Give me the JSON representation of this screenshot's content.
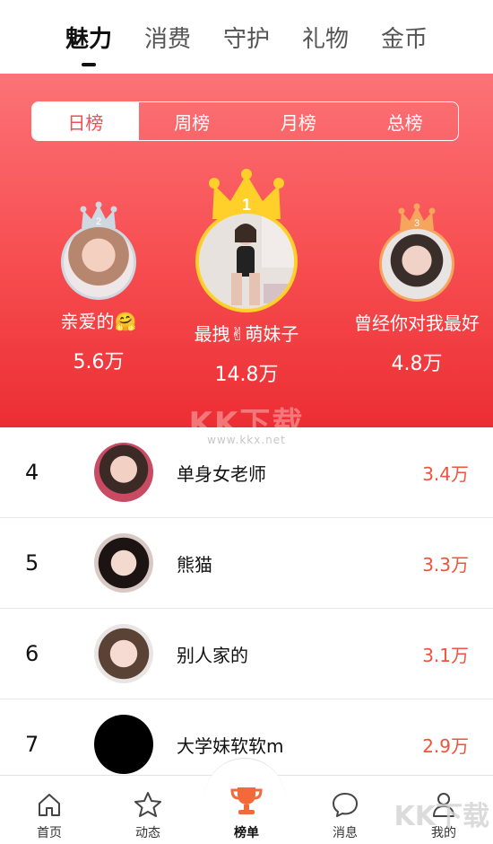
{
  "top_tabs": [
    {
      "label": "魅力",
      "active": true
    },
    {
      "label": "消费"
    },
    {
      "label": "守护"
    },
    {
      "label": "礼物"
    },
    {
      "label": "金币"
    }
  ],
  "period_tabs": [
    {
      "label": "日榜",
      "active": true
    },
    {
      "label": "周榜"
    },
    {
      "label": "月榜"
    },
    {
      "label": "总榜"
    }
  ],
  "podium": {
    "first": {
      "rank": "1",
      "name": "最拽✌萌妹子",
      "score": "14.8万"
    },
    "second": {
      "rank": "2",
      "name": "亲爱的🤗",
      "score": "5.6万"
    },
    "third": {
      "rank": "3",
      "name": "曾经你对我最好",
      "score": "4.8万"
    }
  },
  "watermark": {
    "text": "KK下载",
    "url": "www.kkx.net"
  },
  "list": [
    {
      "rank": "4",
      "name": "单身女老师",
      "value": "3.4万"
    },
    {
      "rank": "5",
      "name": "熊猫",
      "value": "3.3万"
    },
    {
      "rank": "6",
      "name": "别人家的",
      "value": "3.1万"
    },
    {
      "rank": "7",
      "name": "大学妹软软m",
      "value": "2.9万"
    }
  ],
  "bottom_nav": [
    {
      "label": "首页",
      "icon": "home-icon"
    },
    {
      "label": "动态",
      "icon": "star-icon"
    },
    {
      "label": "榜单",
      "icon": "trophy-icon",
      "active": true
    },
    {
      "label": "消息",
      "icon": "chat-icon"
    },
    {
      "label": "我的",
      "icon": "user-icon"
    }
  ],
  "colors": {
    "accent": "#f24e52",
    "value_text": "#f0523b",
    "crown_gold": "#ffd02a",
    "crown_silver": "#cfd7e0",
    "crown_bronze": "#f6a55d",
    "trophy": "#f26a3a"
  }
}
